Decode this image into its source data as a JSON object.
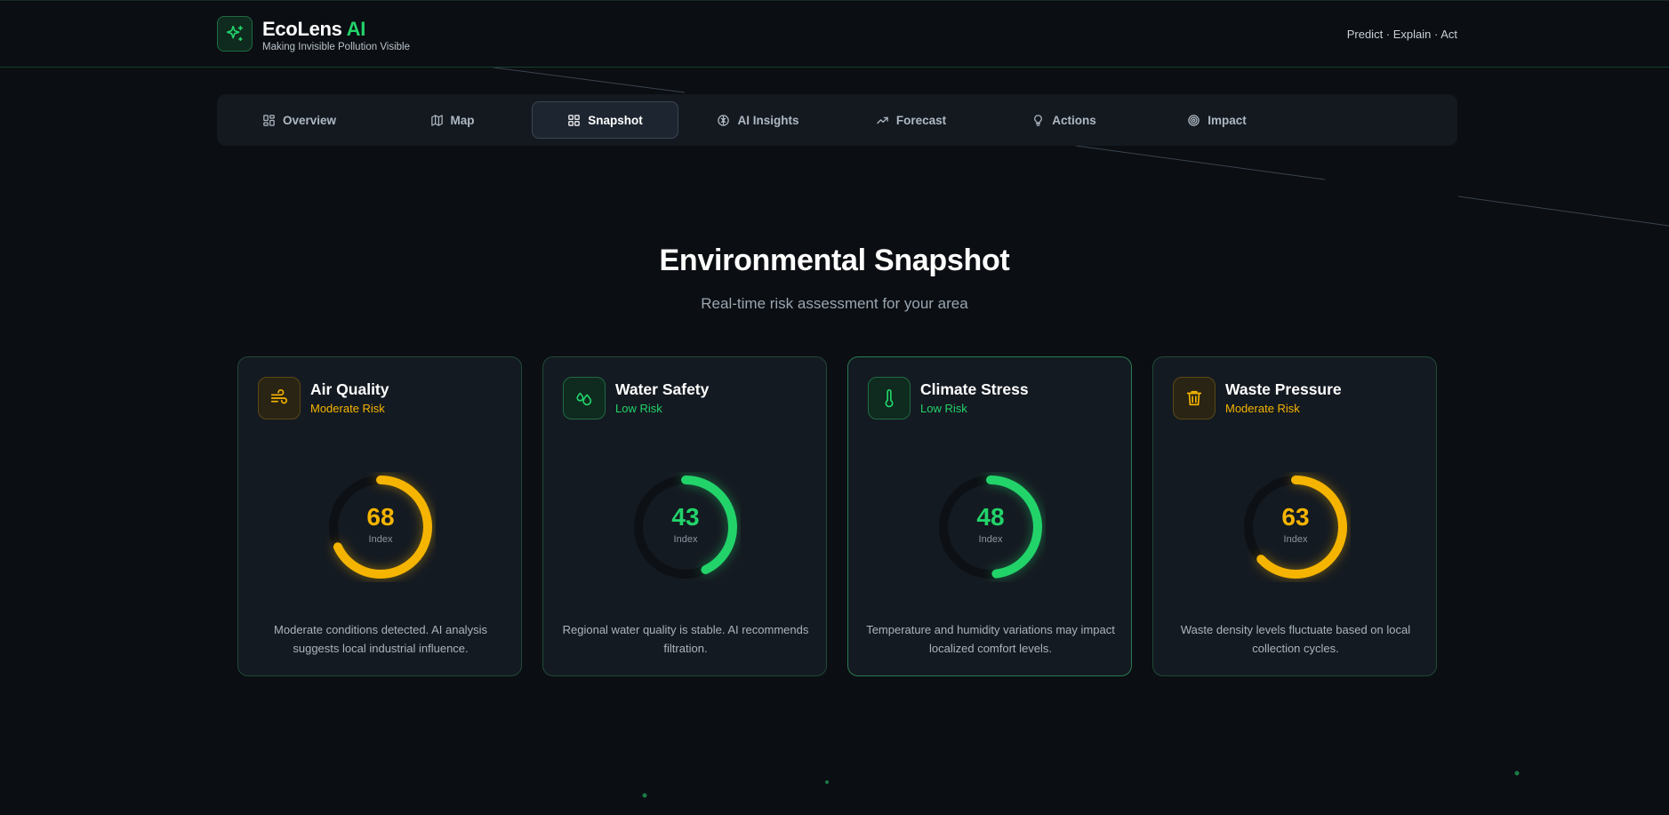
{
  "header": {
    "brand_main": "EcoLens",
    "brand_accent": "AI",
    "tagline": "Making Invisible Pollution Visible",
    "right_text": "Predict · Explain · Act",
    "logo_icon": "sparkles-icon"
  },
  "nav": {
    "tabs": [
      {
        "label": "Overview",
        "icon": "grid-icon"
      },
      {
        "label": "Map",
        "icon": "map-icon"
      },
      {
        "label": "Snapshot",
        "icon": "dashboard-icon",
        "active": true
      },
      {
        "label": "AI Insights",
        "icon": "brain-icon"
      },
      {
        "label": "Forecast",
        "icon": "trending-up-icon"
      },
      {
        "label": "Actions",
        "icon": "lightbulb-icon"
      },
      {
        "label": "Impact",
        "icon": "target-icon"
      }
    ]
  },
  "main": {
    "title": "Environmental Snapshot",
    "subtitle": "Real-time risk assessment for your area"
  },
  "cards": [
    {
      "title": "Air Quality",
      "risk": "Moderate Risk",
      "level": "moderate",
      "value": "68",
      "value_fraction": 0.68,
      "unit_label": "Index",
      "icon": "wind-icon",
      "description": "Moderate conditions detected. AI analysis suggests local industrial influence."
    },
    {
      "title": "Water Safety",
      "risk": "Low Risk",
      "level": "low",
      "value": "43",
      "value_fraction": 0.43,
      "unit_label": "Index",
      "icon": "droplets-icon",
      "description": "Regional water quality is stable. AI recommends filtration."
    },
    {
      "title": "Climate Stress",
      "risk": "Low Risk",
      "level": "low",
      "value": "48",
      "value_fraction": 0.48,
      "unit_label": "Index",
      "icon": "thermometer-icon",
      "description": "Temperature and humidity variations may impact localized comfort levels."
    },
    {
      "title": "Waste Pressure",
      "risk": "Moderate Risk",
      "level": "moderate",
      "value": "63",
      "value_fraction": 0.63,
      "unit_label": "Index",
      "icon": "trash-icon",
      "description": "Waste density levels fluctuate based on local collection cycles."
    }
  ],
  "colors": {
    "accent_green": "#22d36a",
    "moderate_yellow": "#f5b400",
    "background": "#0b0e12",
    "card_bg": "#141a21"
  }
}
